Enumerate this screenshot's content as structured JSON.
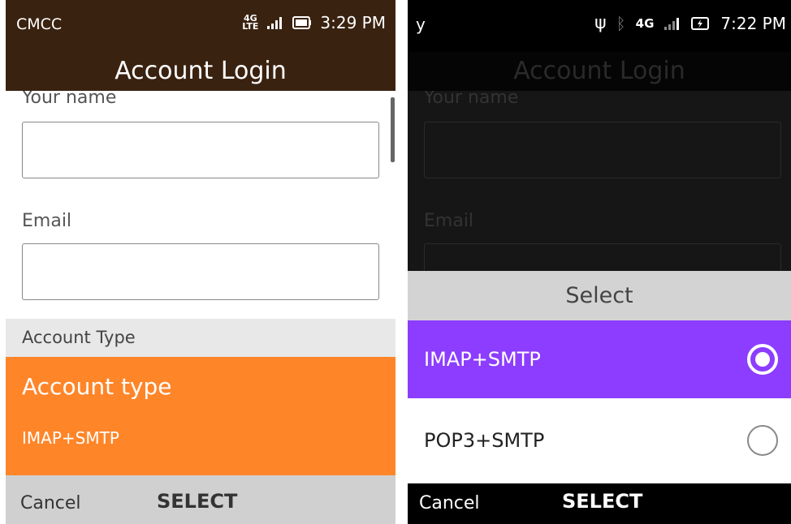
{
  "left": {
    "status": {
      "carrier": "CMCC",
      "network": "4G LTE",
      "time": "3:29 PM"
    },
    "header_title": "Account Login",
    "fields": {
      "name_label": "Your name",
      "name_value": "",
      "email_label": "Email",
      "email_value": ""
    },
    "account_type_section": "Account Type",
    "account_type_item": {
      "title": "Account type",
      "value": "IMAP+SMTP"
    },
    "softkeys": {
      "left": "Cancel",
      "center": "SELECT"
    },
    "colors": {
      "status_bg": "#3a2210",
      "accent": "#ff8529"
    }
  },
  "right": {
    "status": {
      "carrier": "y",
      "network": "4G",
      "time": "7:22 PM"
    },
    "header_title": "Account Login",
    "fields": {
      "name_label": "Your name",
      "email_label": "Email"
    },
    "select_title": "Select",
    "options": [
      {
        "label": "IMAP+SMTP",
        "selected": true
      },
      {
        "label": "POP3+SMTP",
        "selected": false
      }
    ],
    "softkeys": {
      "left": "Cancel",
      "center": "SELECT"
    },
    "colors": {
      "highlight": "#8c3dff"
    }
  }
}
